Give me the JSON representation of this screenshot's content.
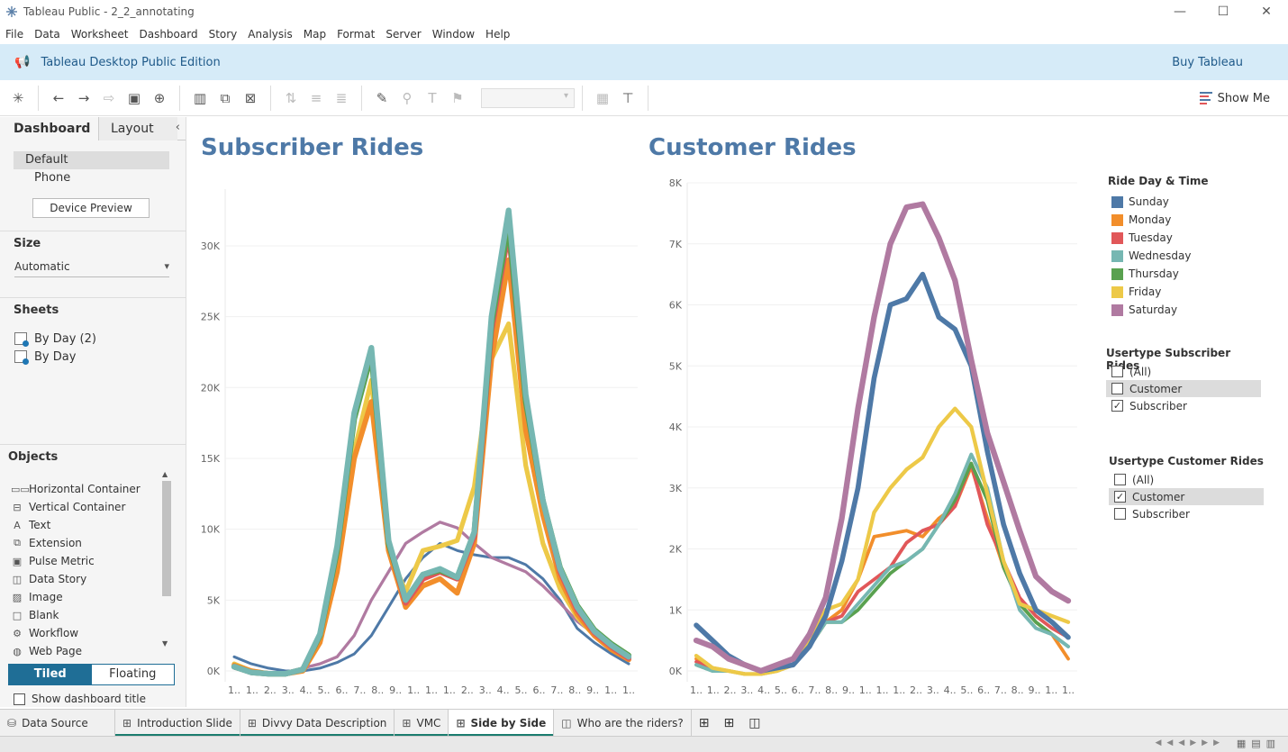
{
  "window": {
    "title": "Tableau Public - 2_2_annotating",
    "minimize": "—",
    "maximize": "☐",
    "close": "✕"
  },
  "menu": [
    "File",
    "Data",
    "Worksheet",
    "Dashboard",
    "Story",
    "Analysis",
    "Map",
    "Format",
    "Server",
    "Window",
    "Help"
  ],
  "banner": {
    "text": "Tableau Desktop Public Edition",
    "buy": "Buy Tableau"
  },
  "toolbar": {
    "show_me": "Show Me"
  },
  "left_panel": {
    "tabs": [
      "Dashboard",
      "Layout"
    ],
    "collapse": "‹",
    "devices": [
      "Default",
      "Phone"
    ],
    "device_preview": "Device Preview",
    "size_heading": "Size",
    "size_value": "Automatic",
    "sheets_heading": "Sheets",
    "sheets": [
      "By Day (2)",
      "By Day"
    ],
    "objects_heading": "Objects",
    "objects": [
      {
        "icon": "▭▭",
        "label": "Horizontal Container"
      },
      {
        "icon": "⊟",
        "label": "Vertical Container"
      },
      {
        "icon": "A",
        "label": "Text"
      },
      {
        "icon": "⧉",
        "label": "Extension"
      },
      {
        "icon": "▣",
        "label": "Pulse Metric"
      },
      {
        "icon": "◫",
        "label": "Data Story"
      },
      {
        "icon": "▨",
        "label": "Image"
      },
      {
        "icon": "□",
        "label": "Blank"
      },
      {
        "icon": "⚙",
        "label": "Workflow"
      },
      {
        "icon": "◍",
        "label": "Web Page"
      }
    ],
    "tiled": "Tiled",
    "floating": "Floating",
    "show_dashboard_title": "Show dashboard title"
  },
  "legend": {
    "title": "Ride Day & Time",
    "items": [
      {
        "label": "Sunday",
        "color": "#4e79a7"
      },
      {
        "label": "Monday",
        "color": "#f28e2b"
      },
      {
        "label": "Tuesday",
        "color": "#e15759"
      },
      {
        "label": "Wednesday",
        "color": "#76b7b2"
      },
      {
        "label": "Thursday",
        "color": "#59a14f"
      },
      {
        "label": "Friday",
        "color": "#edc948"
      },
      {
        "label": "Saturday",
        "color": "#b07aa1"
      }
    ]
  },
  "filters": [
    {
      "title": "Usertype Subscriber Rides",
      "items": [
        {
          "label": "(All)",
          "checked": false,
          "highlight": false
        },
        {
          "label": "Customer",
          "checked": false,
          "highlight": true
        },
        {
          "label": "Subscriber",
          "checked": true,
          "highlight": false
        }
      ]
    },
    {
      "title": "Usertype Customer Rides",
      "items": [
        {
          "label": "(All)",
          "checked": false,
          "highlight": false
        },
        {
          "label": "Customer",
          "checked": true,
          "highlight": true
        },
        {
          "label": "Subscriber",
          "checked": false,
          "highlight": false
        }
      ]
    }
  ],
  "sheet_tabs": [
    {
      "label": "Data Source",
      "icon": "⛁",
      "kind": "datasource"
    },
    {
      "label": "Introduction Slide",
      "icon": "⊞",
      "kind": "dash"
    },
    {
      "label": "Divvy Data Description",
      "icon": "⊞",
      "kind": "dash"
    },
    {
      "label": "VMC",
      "icon": "⊞",
      "kind": "dash"
    },
    {
      "label": "Side by Side",
      "icon": "⊞",
      "kind": "active"
    },
    {
      "label": "Who are the riders?",
      "icon": "◫",
      "kind": "story"
    }
  ],
  "chart_data": [
    {
      "type": "line",
      "title": "Subscriber Rides",
      "x_tick_labels": [
        "1..",
        "1..",
        "2..",
        "3..",
        "4..",
        "5..",
        "6..",
        "7..",
        "8..",
        "9..",
        "1..",
        "1..",
        "1..",
        "2..",
        "3..",
        "4..",
        "5..",
        "6..",
        "7..",
        "8..",
        "9..",
        "1..",
        "1.."
      ],
      "y_ticks": [
        "0K",
        "5K",
        "10K",
        "15K",
        "20K",
        "25K",
        "30K"
      ],
      "ylim": [
        0,
        34000
      ],
      "x_count": 24,
      "series": [
        {
          "name": "Sunday",
          "values": [
            1000,
            500,
            200,
            0,
            0,
            200,
            600,
            1200,
            2500,
            4500,
            6500,
            8000,
            9000,
            8500,
            8200,
            8000,
            8000,
            7500,
            6500,
            5000,
            3000,
            2000,
            1200,
            500
          ]
        },
        {
          "name": "Monday",
          "values": [
            400,
            0,
            -200,
            -200,
            0,
            2000,
            7000,
            15000,
            19000,
            8500,
            4500,
            6000,
            6500,
            5500,
            9000,
            22000,
            29000,
            17000,
            11000,
            6500,
            4000,
            2500,
            1500,
            800
          ]
        },
        {
          "name": "Tuesday",
          "values": [
            300,
            -100,
            -200,
            -200,
            100,
            2500,
            8500,
            18000,
            22500,
            9000,
            4800,
            6500,
            7000,
            6500,
            9500,
            24000,
            31000,
            19000,
            12000,
            7000,
            4300,
            2700,
            1700,
            900
          ]
        },
        {
          "name": "Wednesday",
          "values": [
            300,
            -100,
            -200,
            -200,
            100,
            2600,
            8800,
            18200,
            22800,
            9200,
            5000,
            6800,
            7200,
            6600,
            9800,
            25000,
            32500,
            19500,
            12000,
            7200,
            4500,
            2800,
            1800,
            1000
          ]
        },
        {
          "name": "Thursday",
          "values": [
            300,
            -100,
            -200,
            -200,
            100,
            2500,
            8500,
            17800,
            22300,
            9000,
            5000,
            6800,
            7100,
            6600,
            9800,
            24500,
            31500,
            19000,
            12000,
            7300,
            4600,
            2900,
            1900,
            1100
          ]
        },
        {
          "name": "Friday",
          "values": [
            500,
            0,
            -200,
            -200,
            100,
            2200,
            7500,
            15500,
            20500,
            8500,
            5600,
            8500,
            8800,
            9200,
            13000,
            22000,
            24500,
            14500,
            9000,
            5800,
            3800,
            2500,
            1600,
            900
          ]
        },
        {
          "name": "Saturday",
          "values": [
            200,
            -100,
            -200,
            -100,
            200,
            500,
            1000,
            2500,
            5000,
            7000,
            9000,
            9800,
            10500,
            10100,
            9000,
            8000,
            7500,
            7000,
            6000,
            4800,
            3500,
            2600,
            1800,
            800
          ]
        }
      ]
    },
    {
      "type": "line",
      "title": "Customer Rides",
      "x_tick_labels": [
        "1..",
        "1..",
        "2..",
        "3..",
        "4..",
        "5..",
        "6..",
        "7..",
        "8..",
        "9..",
        "1..",
        "1..",
        "1..",
        "2..",
        "3..",
        "4..",
        "5..",
        "6..",
        "7..",
        "8..",
        "9..",
        "1..",
        "1.."
      ],
      "y_ticks": [
        "0K",
        "1K",
        "2K",
        "3K",
        "4K",
        "5K",
        "6K",
        "7K",
        "8K"
      ],
      "ylim": [
        0,
        8000
      ],
      "x_count": 24,
      "series": [
        {
          "name": "Sunday",
          "values": [
            750,
            500,
            250,
            100,
            0,
            50,
            100,
            400,
            900,
            1800,
            3000,
            4800,
            6000,
            6100,
            6500,
            5800,
            5600,
            5000,
            3600,
            2400,
            1600,
            1000,
            800,
            550
          ]
        },
        {
          "name": "Monday",
          "values": [
            200,
            50,
            0,
            -50,
            -50,
            0,
            100,
            400,
            800,
            1000,
            1500,
            2200,
            2250,
            2300,
            2200,
            2500,
            2700,
            3350,
            2500,
            1700,
            1100,
            800,
            600,
            200
          ]
        },
        {
          "name": "Tuesday",
          "values": [
            150,
            50,
            0,
            -50,
            -50,
            0,
            100,
            400,
            800,
            900,
            1300,
            1500,
            1700,
            2100,
            2300,
            2400,
            2700,
            3400,
            2400,
            1800,
            1200,
            900,
            700,
            550
          ]
        },
        {
          "name": "Wednesday",
          "values": [
            100,
            0,
            0,
            -50,
            -50,
            0,
            100,
            400,
            800,
            800,
            1100,
            1400,
            1700,
            1800,
            2000,
            2400,
            2900,
            3550,
            3000,
            1800,
            1000,
            700,
            600,
            400
          ]
        },
        {
          "name": "Thursday",
          "values": [
            100,
            0,
            0,
            -50,
            -50,
            0,
            100,
            400,
            800,
            800,
            1000,
            1300,
            1600,
            1800,
            2000,
            2400,
            2800,
            3400,
            2800,
            1700,
            1100,
            800,
            600,
            400
          ]
        },
        {
          "name": "Friday",
          "values": [
            250,
            50,
            0,
            -50,
            -50,
            0,
            100,
            500,
            1000,
            1100,
            1500,
            2600,
            3000,
            3300,
            3500,
            4000,
            4300,
            4000,
            2900,
            1800,
            1100,
            1000,
            900,
            800
          ]
        },
        {
          "name": "Saturday",
          "values": [
            500,
            400,
            200,
            100,
            0,
            100,
            200,
            600,
            1200,
            2500,
            4300,
            5800,
            7000,
            7600,
            7650,
            7100,
            6400,
            5100,
            3900,
            3100,
            2300,
            1550,
            1300,
            1150
          ]
        }
      ]
    }
  ]
}
